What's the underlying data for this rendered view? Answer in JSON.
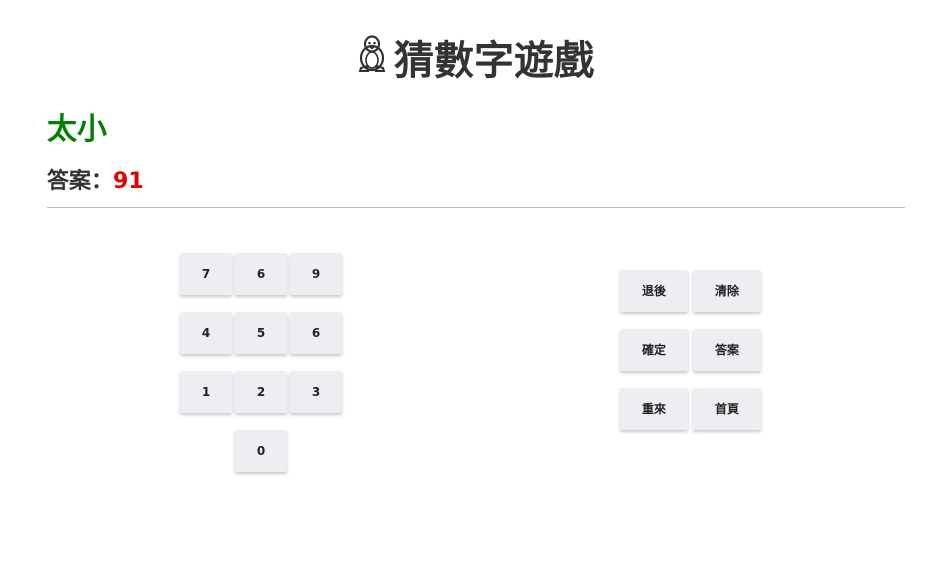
{
  "header": {
    "icon": "penguin-icon",
    "title": "猜數字遊戲"
  },
  "status": {
    "text": "太小",
    "color": "#008000"
  },
  "answer": {
    "label": "答案：",
    "value": "91",
    "value_color": "#e00000"
  },
  "keypad": {
    "keys": [
      "7",
      "6",
      "9",
      "4",
      "5",
      "6",
      "1",
      "2",
      "3",
      "0"
    ]
  },
  "actions": {
    "backspace": "退後",
    "clear": "清除",
    "confirm": "確定",
    "show_answer": "答案",
    "restart": "重來",
    "home": "首頁"
  }
}
